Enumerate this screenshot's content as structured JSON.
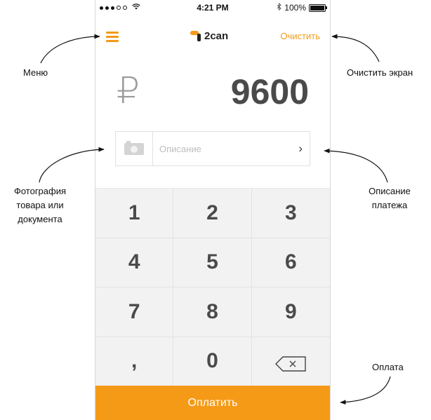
{
  "status_bar": {
    "time": "4:21 PM",
    "battery": "100%",
    "bluetooth_icon": "bluetooth-icon"
  },
  "nav": {
    "brand": "2can",
    "clear_label": "Очистить"
  },
  "amount": {
    "currency_symbol": "₽",
    "value": "9600"
  },
  "description": {
    "placeholder": "Описание"
  },
  "keypad": {
    "keys": [
      "1",
      "2",
      "3",
      "4",
      "5",
      "6",
      "7",
      "8",
      "9",
      ",",
      "0"
    ]
  },
  "pay": {
    "label": "Оплатить"
  },
  "annotations": {
    "menu": "Меню",
    "clear": "Очистить экран",
    "photo": [
      "Фотография",
      "товара или",
      "документа"
    ],
    "description": [
      "Описание",
      "платежа"
    ],
    "pay": "Оплата"
  },
  "colors": {
    "accent": "#f59a17",
    "keypad_bg": "#f2f2f2",
    "amount_text": "#4a4a4a"
  }
}
